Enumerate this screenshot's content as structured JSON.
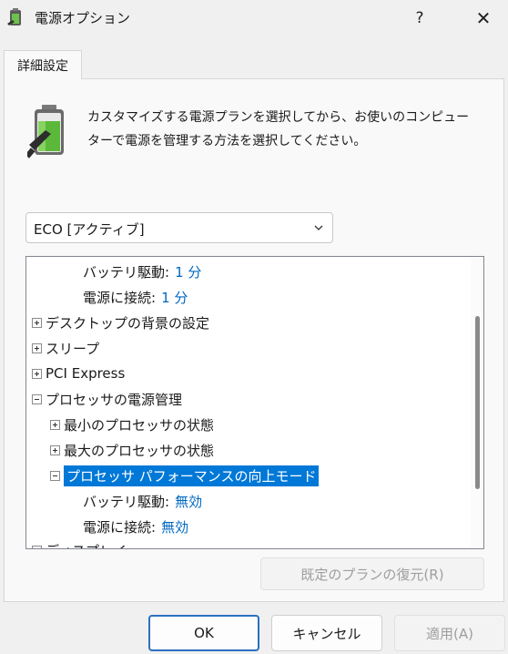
{
  "window": {
    "title": "電源オプション",
    "help_label": "?",
    "close_label": "✕",
    "icon": "power-options-icon"
  },
  "tab": {
    "label": "詳細設定"
  },
  "description": {
    "line1": "カスタマイズする電源プランを選択してから、お使いのコンピュー",
    "line2": "ターで電源を管理する方法を選択してください。",
    "icon": "battery-plug-icon"
  },
  "plan_select": {
    "value": "ECO [アクティブ]",
    "icon": "chevron-down-icon"
  },
  "tree": {
    "rows": [
      {
        "label": "バッテリ駆動:",
        "value": "1 分"
      },
      {
        "label": "電源に接続:",
        "value": "1 分"
      },
      {
        "label": "デスクトップの背景の設定",
        "expander": "plus"
      },
      {
        "label": "スリープ",
        "expander": "plus"
      },
      {
        "label": "PCI Express",
        "expander": "plus"
      },
      {
        "label": "プロセッサの電源管理",
        "expander": "minus"
      },
      {
        "label": "最小のプロセッサの状態",
        "expander": "plus"
      },
      {
        "label": "最大のプロセッサの状態",
        "expander": "plus"
      },
      {
        "label": "プロセッサ パフォーマンスの向上モード",
        "expander": "minus",
        "selected": true
      },
      {
        "label": "バッテリ駆動:",
        "value": "無効"
      },
      {
        "label": "電源に接続:",
        "value": "無効"
      },
      {
        "label": "ディスプレイ",
        "expander": "plus"
      }
    ]
  },
  "buttons": {
    "restore": "既定のプランの復元(R)",
    "ok": "OK",
    "cancel": "キャンセル",
    "apply": "適用(A)"
  },
  "colors": {
    "accent": "#0078d7",
    "value_text": "#0067c0",
    "ok_border": "#2d6fc2"
  }
}
